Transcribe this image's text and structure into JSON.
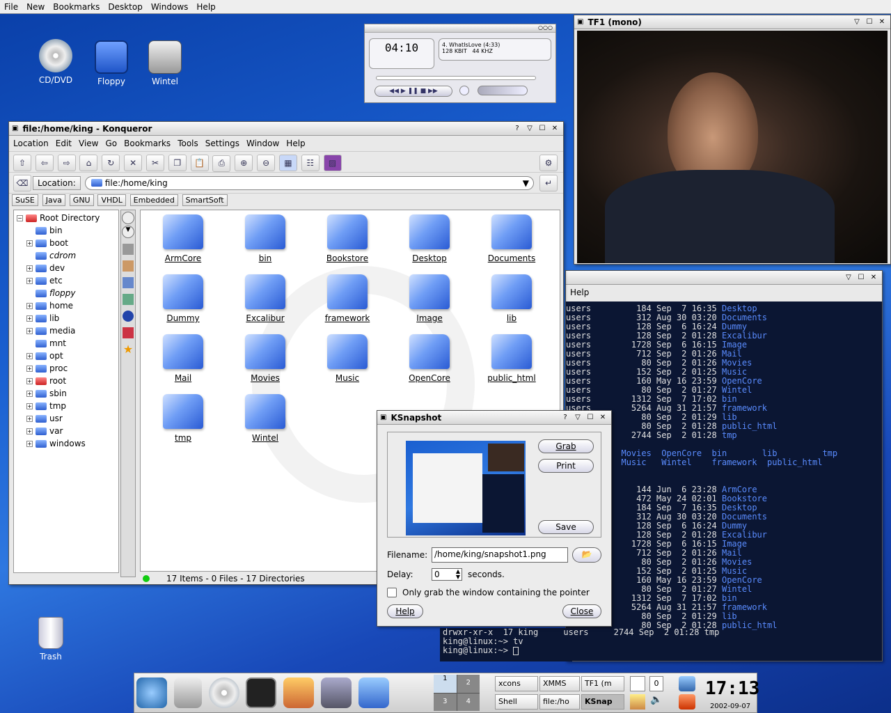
{
  "topmenu": [
    "File",
    "New",
    "Bookmarks",
    "Desktop",
    "Windows",
    "Help"
  ],
  "desktop_icons": [
    {
      "label": "CD/DVD",
      "icon": "dvd-icon"
    },
    {
      "label": "Floppy",
      "icon": "floppy-icon"
    },
    {
      "label": "Wintel",
      "icon": "harddisk-icon"
    },
    {
      "label": "Trash",
      "icon": "trash-icon"
    }
  ],
  "xmms": {
    "time": "04:10",
    "track": "4. WhatIsLove (4:33)",
    "kbps": "128 KBIT",
    "khz": "44 KHZ"
  },
  "tv": {
    "title": "TF1 (mono)"
  },
  "konqueror": {
    "title": "file:/home/king - Konqueror",
    "menu": [
      "Location",
      "Edit",
      "View",
      "Go",
      "Bookmarks",
      "Tools",
      "Settings",
      "Window",
      "Help"
    ],
    "location_label": "Location:",
    "location_value": "file:/home/king",
    "bookmarks": [
      "SuSE",
      "Java",
      "GNU",
      "VHDL",
      "Embedded",
      "SmartSoft"
    ],
    "tree_root": "Root Directory",
    "tree": [
      "bin",
      "boot",
      "cdrom",
      "dev",
      "etc",
      "floppy",
      "home",
      "lib",
      "media",
      "mnt",
      "opt",
      "proc",
      "root",
      "sbin",
      "tmp",
      "usr",
      "var",
      "windows"
    ],
    "files": [
      "ArmCore",
      "bin",
      "Bookstore",
      "Desktop",
      "Documents",
      "Dummy",
      "Excalibur",
      "framework",
      "Image",
      "lib",
      "Mail",
      "Movies",
      "Music",
      "OpenCore",
      "public_html",
      "tmp",
      "Wintel"
    ],
    "status": "17 Items - 0 Files - 17 Directories"
  },
  "terminal": {
    "menu": "Help",
    "block1": [
      [
        "users",
        "184",
        "Sep",
        " 7",
        "16:35",
        "Desktop"
      ],
      [
        "users",
        "312",
        "Aug",
        "30",
        "03:20",
        "Documents"
      ],
      [
        "users",
        "128",
        "Sep",
        " 6",
        "16:24",
        "Dummy"
      ],
      [
        "users",
        "128",
        "Sep",
        " 2",
        "01:28",
        "Excalibur"
      ],
      [
        "users",
        "1728",
        "Sep",
        " 6",
        "16:15",
        "Image"
      ],
      [
        "users",
        "712",
        "Sep",
        " 2",
        "01:26",
        "Mail"
      ],
      [
        "users",
        "80",
        "Sep",
        " 2",
        "01:26",
        "Movies"
      ],
      [
        "users",
        "152",
        "Sep",
        " 2",
        "01:25",
        "Music"
      ],
      [
        "users",
        "160",
        "May",
        "16",
        "23:59",
        "OpenCore"
      ],
      [
        "users",
        "80",
        "Sep",
        " 2",
        "01:27",
        "Wintel"
      ],
      [
        "users",
        "1312",
        "Sep",
        " 7",
        "17:02",
        "bin"
      ],
      [
        "users",
        "5264",
        "Aug",
        "31",
        "21:57",
        "framework"
      ],
      [
        "users",
        "80",
        "Sep",
        " 2",
        "01:29",
        "lib"
      ],
      [
        "users",
        "80",
        "Sep",
        " 2",
        "01:28",
        "public_html"
      ],
      [
        "users",
        "2744",
        "Sep",
        " 2",
        "01:28",
        "tmp"
      ]
    ],
    "ls1": "age  Movies  OpenCore  bin       lib         tmp",
    "ls2": "il   Music   Wintel    framework  public_html",
    "block2": [
      [
        "144",
        "Jun",
        " 6",
        "23:28",
        "ArmCore"
      ],
      [
        "472",
        "May",
        "24",
        "02:01",
        "Bookstore"
      ],
      [
        "184",
        "Sep",
        " 7",
        "16:35",
        "Desktop"
      ],
      [
        "312",
        "Aug",
        "30",
        "03:20",
        "Documents"
      ],
      [
        "128",
        "Sep",
        " 6",
        "16:24",
        "Dummy"
      ],
      [
        "128",
        "Sep",
        " 2",
        "01:28",
        "Excalibur"
      ],
      [
        "1728",
        "Sep",
        " 6",
        "16:15",
        "Image"
      ],
      [
        "712",
        "Sep",
        " 2",
        "01:26",
        "Mail"
      ],
      [
        "80",
        "Sep",
        " 2",
        "01:26",
        "Movies"
      ],
      [
        "152",
        "Sep",
        " 2",
        "01:25",
        "Music"
      ],
      [
        "160",
        "May",
        "16",
        "23:59",
        "OpenCore"
      ],
      [
        "80",
        "Sep",
        " 2",
        "01:27",
        "Wintel"
      ],
      [
        "1312",
        "Sep",
        " 7",
        "17:02",
        "bin"
      ],
      [
        "5264",
        "Aug",
        "31",
        "21:57",
        "framework"
      ],
      [
        "80",
        "Sep",
        " 2",
        "01:29",
        "lib"
      ],
      [
        "80",
        "Sep",
        " 2",
        "01:28",
        "public_html"
      ]
    ],
    "last_line": "drwxr-xr-x  17 king     users     2744 Sep  2 01:28 tmp",
    "prompt1": "king@linux:~> tv",
    "prompt2": "king@linux:~> "
  },
  "ksnapshot": {
    "title": "KSnapshot",
    "grab": "Grab",
    "print": "Print",
    "save": "Save",
    "filename_label": "Filename:",
    "filename": "/home/king/snapshot1.png",
    "delay_label": "Delay:",
    "delay": "0",
    "seconds": "seconds.",
    "only_grab": "Only grab the window containing the pointer",
    "help": "Help",
    "close": "Close"
  },
  "panel": {
    "desktops": [
      "1",
      "2",
      "3",
      "4"
    ],
    "tasks": [
      "xcons",
      "XMMS",
      "TF1 (m",
      "Shell",
      "file:/ho",
      "KSnap"
    ],
    "counter": "0",
    "clock": "17:13",
    "date": "2002-09-07"
  }
}
